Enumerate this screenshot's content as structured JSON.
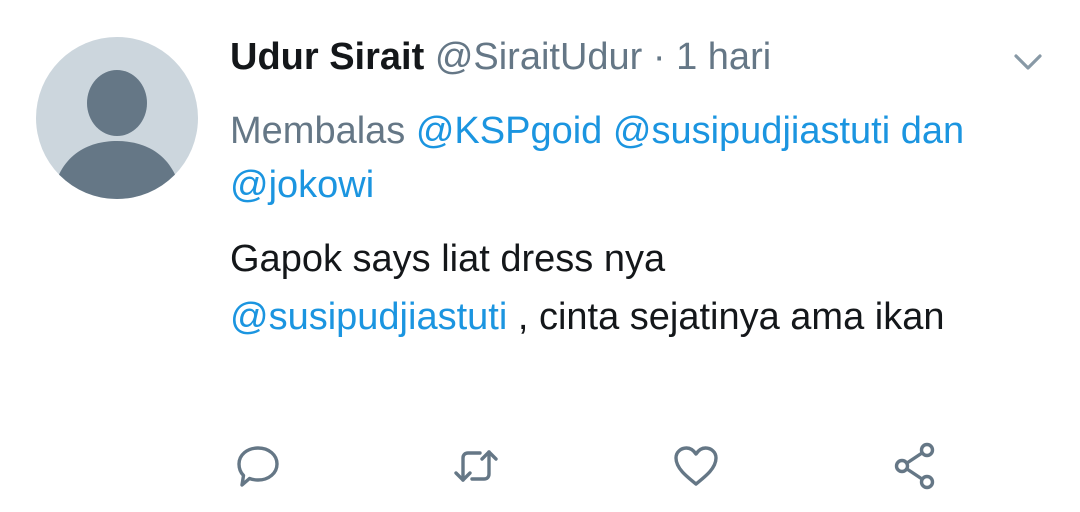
{
  "tweet": {
    "display_name": "Udur Sirait",
    "handle": "@SiraitUdur",
    "separator": "·",
    "timestamp": "1 hari",
    "reply": {
      "prefix": "Membalas",
      "mentions": [
        "@KSPgoid",
        "@susipudjiastuti"
      ],
      "connector": "dan",
      "last_mention": "@jokowi"
    },
    "body": {
      "line1": "Gapok says liat dress nya",
      "mention": "@susipudjiastuti",
      "rest": " , cinta sejatinya ama ikan"
    }
  },
  "icons": {
    "caret": "chevron-down-icon",
    "reply": "reply-icon",
    "retweet": "retweet-icon",
    "like": "heart-icon",
    "share": "share-icon"
  },
  "colors": {
    "text_primary": "#14171a",
    "text_secondary": "#657786",
    "link": "#1b95e0",
    "avatar_bg": "#ccd6dd",
    "avatar_figure": "#657786",
    "icon": "#657786"
  }
}
